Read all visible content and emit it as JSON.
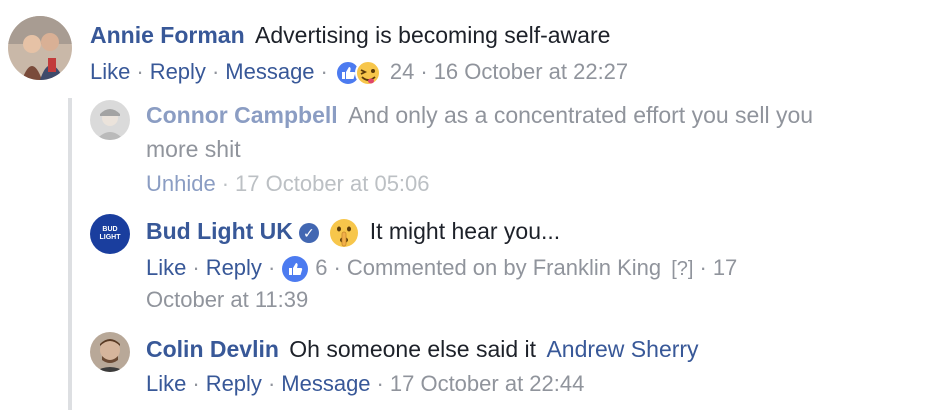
{
  "comment1": {
    "author": "Annie Forman",
    "text": "Advertising is becoming self-aware",
    "actions": {
      "like": "Like",
      "reply": "Reply",
      "message": "Message"
    },
    "reaction_count": "24",
    "timestamp": "16 October at 22:27"
  },
  "reply1": {
    "author": "Connor Campbell",
    "text_line1": "And only as a concentrated effort you sell you",
    "text_line2": "more shit",
    "actions": {
      "unhide": "Unhide"
    },
    "timestamp": "17 October at 05:06"
  },
  "reply2": {
    "author": "Bud Light UK",
    "avatar_text": "BUD LIGHT",
    "text": "It might hear you...",
    "actions": {
      "like": "Like",
      "reply": "Reply"
    },
    "reaction_count": "6",
    "commented_on_by": "Commented on by Franklin King",
    "help": "[?]",
    "timestamp_part1": "17",
    "timestamp_part2": "October at 11:39"
  },
  "reply3": {
    "author": "Colin Devlin",
    "text": "Oh someone else said it",
    "mention": "Andrew Sherry",
    "actions": {
      "like": "Like",
      "reply": "Reply",
      "message": "Message"
    },
    "timestamp": "17 October at 22:44"
  },
  "colors": {
    "link": "#385898",
    "meta": "#90949c",
    "faded_link": "#8b9dc3",
    "like_blue": "#4c7bf0"
  }
}
